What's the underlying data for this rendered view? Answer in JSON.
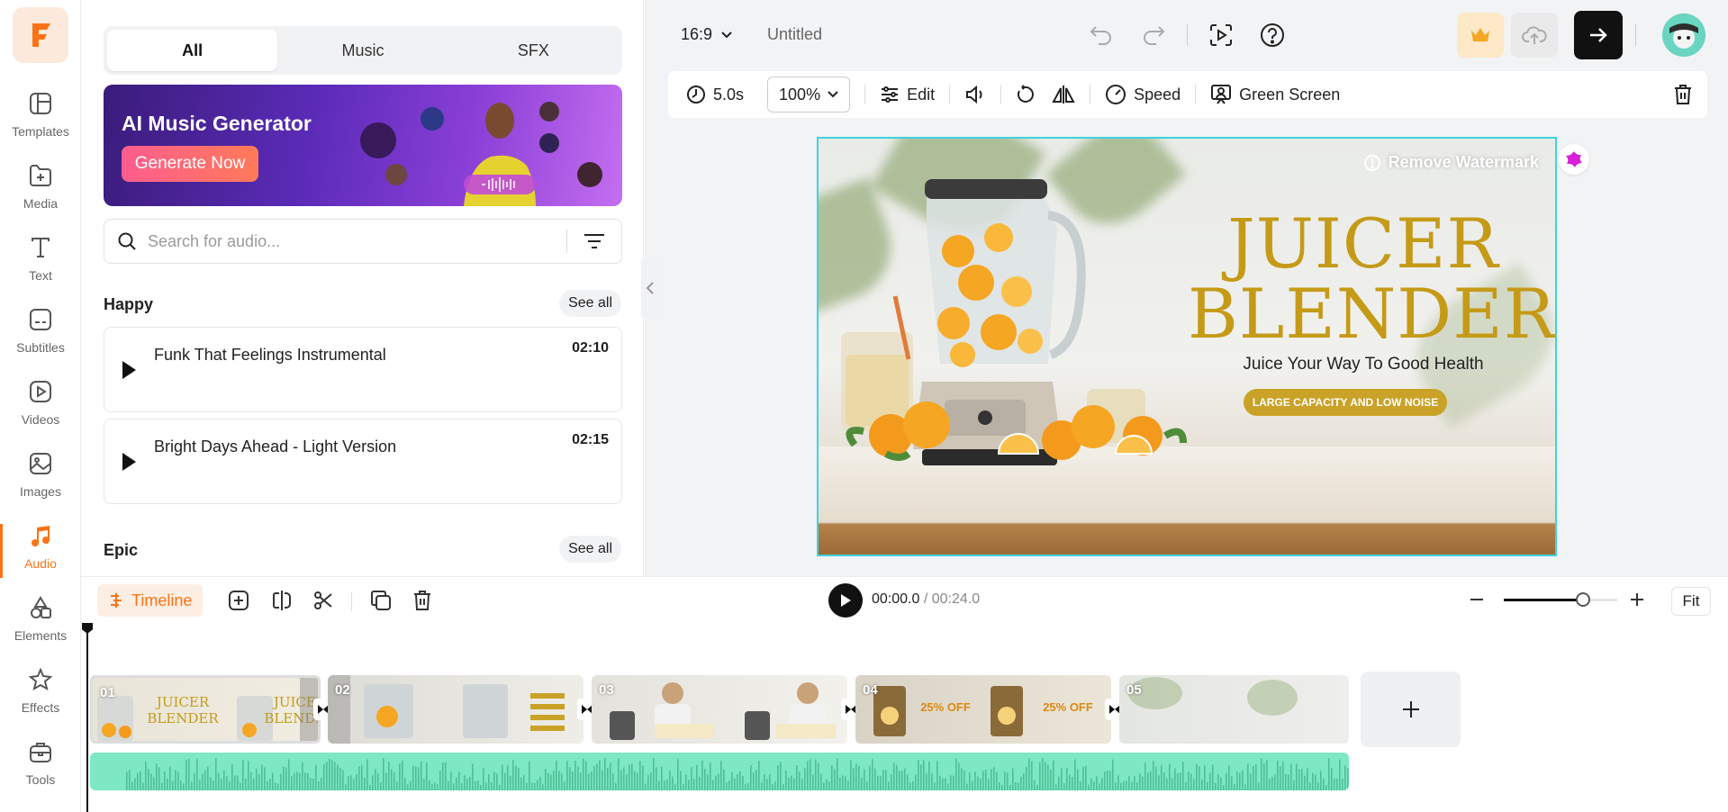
{
  "rail": {
    "items": [
      {
        "label": "Templates",
        "icon": "templates-icon"
      },
      {
        "label": "Media",
        "icon": "media-icon"
      },
      {
        "label": "Text",
        "icon": "text-icon"
      },
      {
        "label": "Subtitles",
        "icon": "subtitles-icon"
      },
      {
        "label": "Videos",
        "icon": "videos-icon"
      },
      {
        "label": "Images",
        "icon": "images-icon"
      },
      {
        "label": "Audio",
        "icon": "audio-icon",
        "active": true
      },
      {
        "label": "Elements",
        "icon": "elements-icon"
      },
      {
        "label": "Effects",
        "icon": "effects-icon"
      },
      {
        "label": "Tools",
        "icon": "tools-icon"
      }
    ]
  },
  "panel": {
    "tabs": [
      {
        "label": "All",
        "active": true
      },
      {
        "label": "Music"
      },
      {
        "label": "SFX"
      }
    ],
    "banner": {
      "title": "AI Music Generator",
      "button": "Generate Now"
    },
    "search": {
      "placeholder": "Search for audio..."
    },
    "sections": [
      {
        "title": "Happy",
        "see_all": "See all",
        "tracks": [
          {
            "name": "Funk That Feelings Instrumental",
            "duration": "02:10"
          },
          {
            "name": "Bright Days Ahead - Light Version",
            "duration": "02:15"
          }
        ]
      },
      {
        "title": "Epic",
        "see_all": "See all",
        "tracks": []
      }
    ]
  },
  "topbar": {
    "ratio": "16:9",
    "title": "Untitled"
  },
  "toolbar": {
    "duration": "5.0s",
    "zoom": "100%",
    "edit": "Edit",
    "speed": "Speed",
    "green_screen": "Green Screen"
  },
  "canvas": {
    "watermark": "Remove Watermark",
    "headline_line1": "JUICER",
    "headline_line2": "BLENDER",
    "subline": "Juice Your Way To Good Health",
    "pill": "LARGE CAPACITY AND LOW NOISE"
  },
  "timeline": {
    "label": "Timeline",
    "current_time": "00:00.0",
    "total_time": "/ 00:24.0",
    "fit": "Fit",
    "zoom_level": 0.7,
    "clips": [
      {
        "num": "01"
      },
      {
        "num": "02"
      },
      {
        "num": "03"
      },
      {
        "num": "04"
      },
      {
        "num": "05"
      }
    ]
  },
  "colors": {
    "accent": "#f97316",
    "headline_gold": "#c59a17",
    "audio_track": "#7de8c3",
    "selection": "#3fd3e0"
  }
}
